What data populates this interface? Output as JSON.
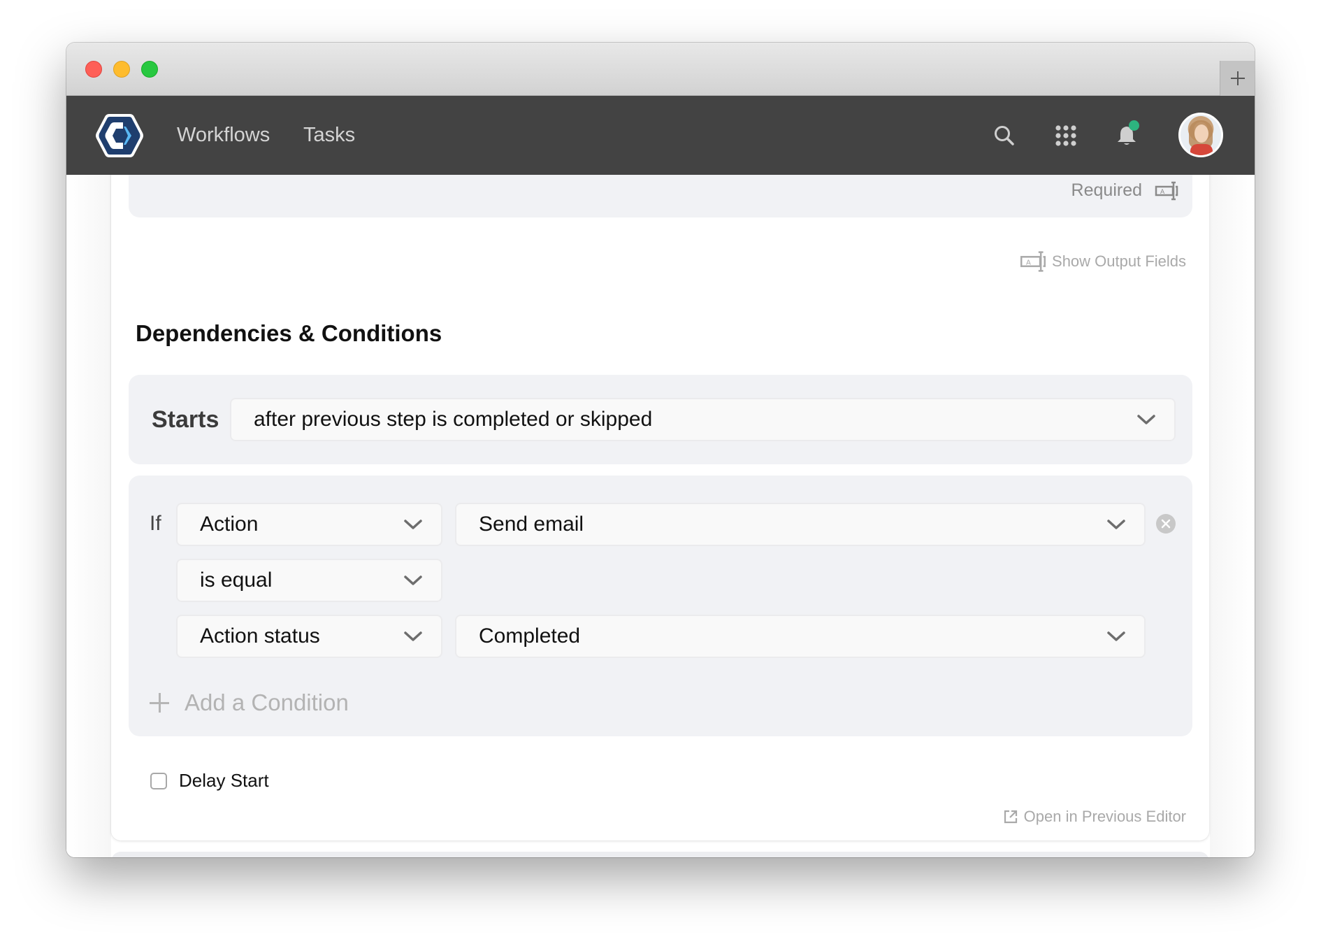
{
  "window": {
    "new_tab_icon": "plus-icon"
  },
  "nav": {
    "logo": "hexagon-c-logo",
    "links": [
      {
        "label": "Workflows"
      },
      {
        "label": "Tasks"
      }
    ],
    "icons": [
      "search-icon",
      "apps-grid-icon",
      "bell-icon",
      "avatar"
    ],
    "notification_badge_color": "#2db37f"
  },
  "step": {
    "required_label": "Required",
    "show_output_fields_label": "Show Output Fields",
    "section_title": "Dependencies & Conditions",
    "starts": {
      "label": "Starts",
      "value": "after previous step is completed or skipped"
    },
    "conditions": {
      "if_label": "If",
      "rows": [
        {
          "left": "Action",
          "right": "Send email"
        },
        {
          "left": "is equal"
        },
        {
          "left": "Action status",
          "right": "Completed"
        }
      ],
      "add_label": "Add a Condition"
    },
    "delay_start": {
      "label": "Delay Start",
      "checked": false
    },
    "open_previous_editor_label": "Open in Previous Editor"
  }
}
